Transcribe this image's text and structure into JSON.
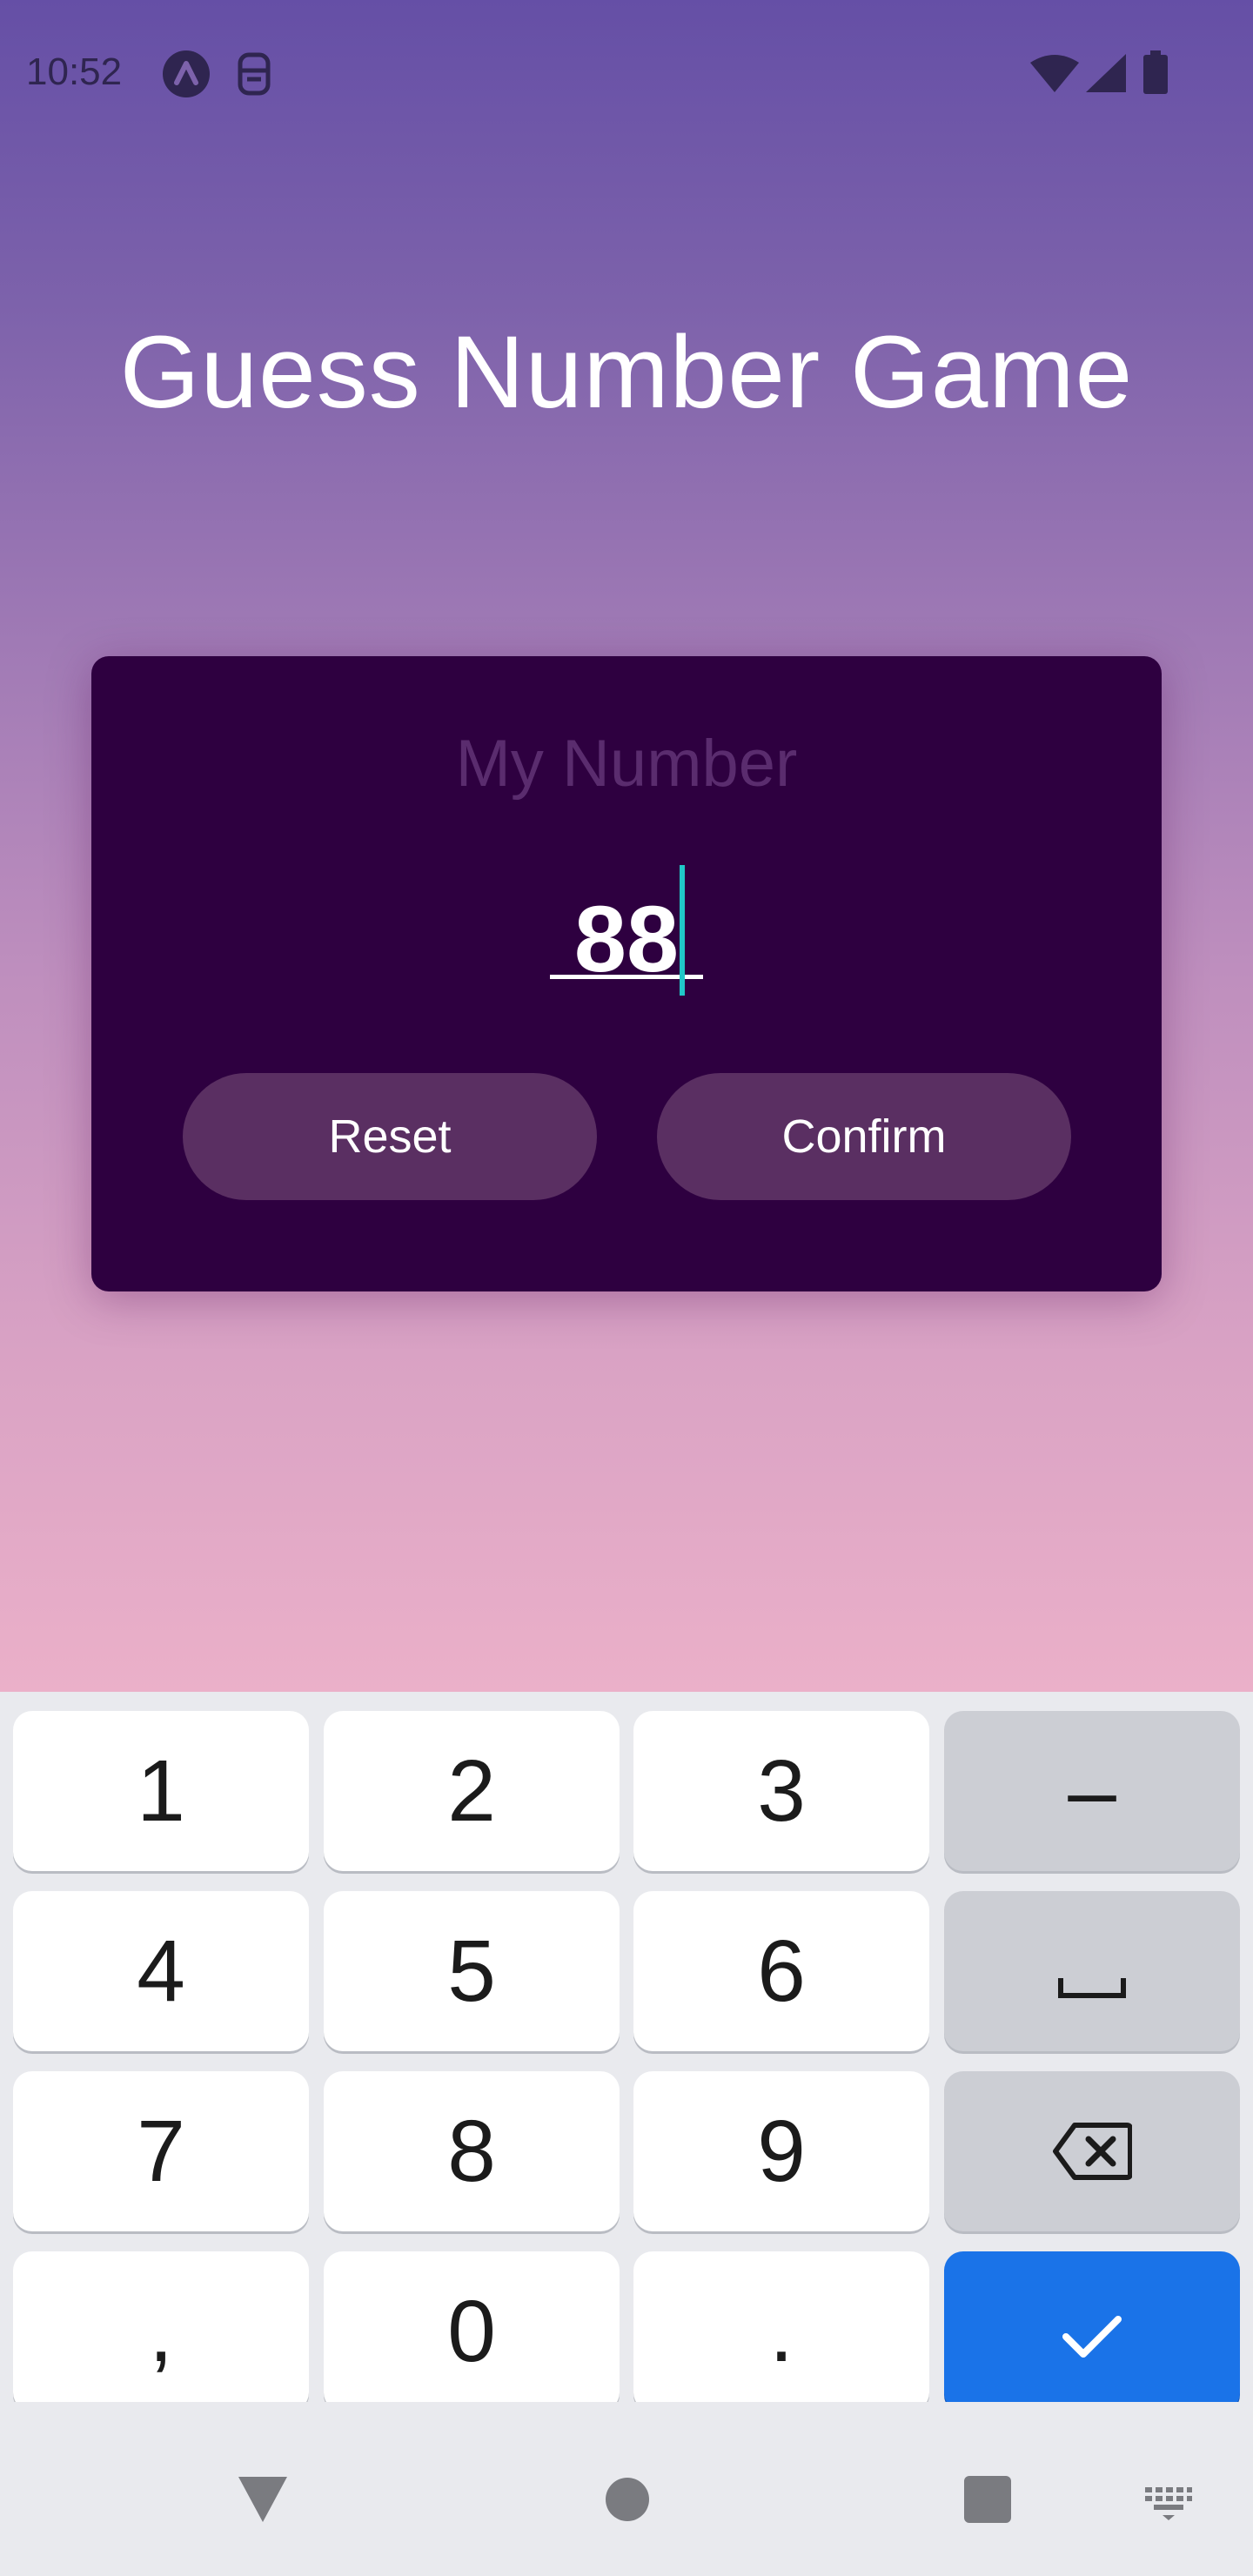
{
  "status_bar": {
    "time": "10:52"
  },
  "app": {
    "title": "Guess Number Game"
  },
  "card": {
    "label": "My Number",
    "input_value": "88",
    "reset_label": "Reset",
    "confirm_label": "Confirm"
  },
  "keyboard": {
    "rows": [
      [
        "1",
        "2",
        "3",
        "–"
      ],
      [
        "4",
        "5",
        "6",
        "space"
      ],
      [
        "7",
        "8",
        "9",
        "backspace"
      ],
      [
        ",",
        "0",
        ".",
        "done"
      ]
    ],
    "k1": "1",
    "k2": "2",
    "k3": "3",
    "minus": "–",
    "k4": "4",
    "k5": "5",
    "k6": "6",
    "k7": "7",
    "k8": "8",
    "k9": "9",
    "comma": ",",
    "k0": "0",
    "period": "."
  },
  "colors": {
    "gradient_top": "#654fa6",
    "gradient_bottom": "#ebb0c9",
    "card_bg": "#2e0040",
    "button_bg": "#5a2f62",
    "cursor": "#20c8c8",
    "enter_key": "#1a73e8"
  },
  "icons": {
    "status": [
      "app-notification-icon",
      "sim-toolkit-icon",
      "wifi-icon",
      "cell-signal-icon",
      "battery-icon"
    ],
    "keyboard": [
      "space-icon",
      "backspace-icon",
      "check-icon"
    ],
    "nav": [
      "back-icon",
      "home-icon",
      "recents-icon",
      "keyboard-switch-icon"
    ]
  }
}
